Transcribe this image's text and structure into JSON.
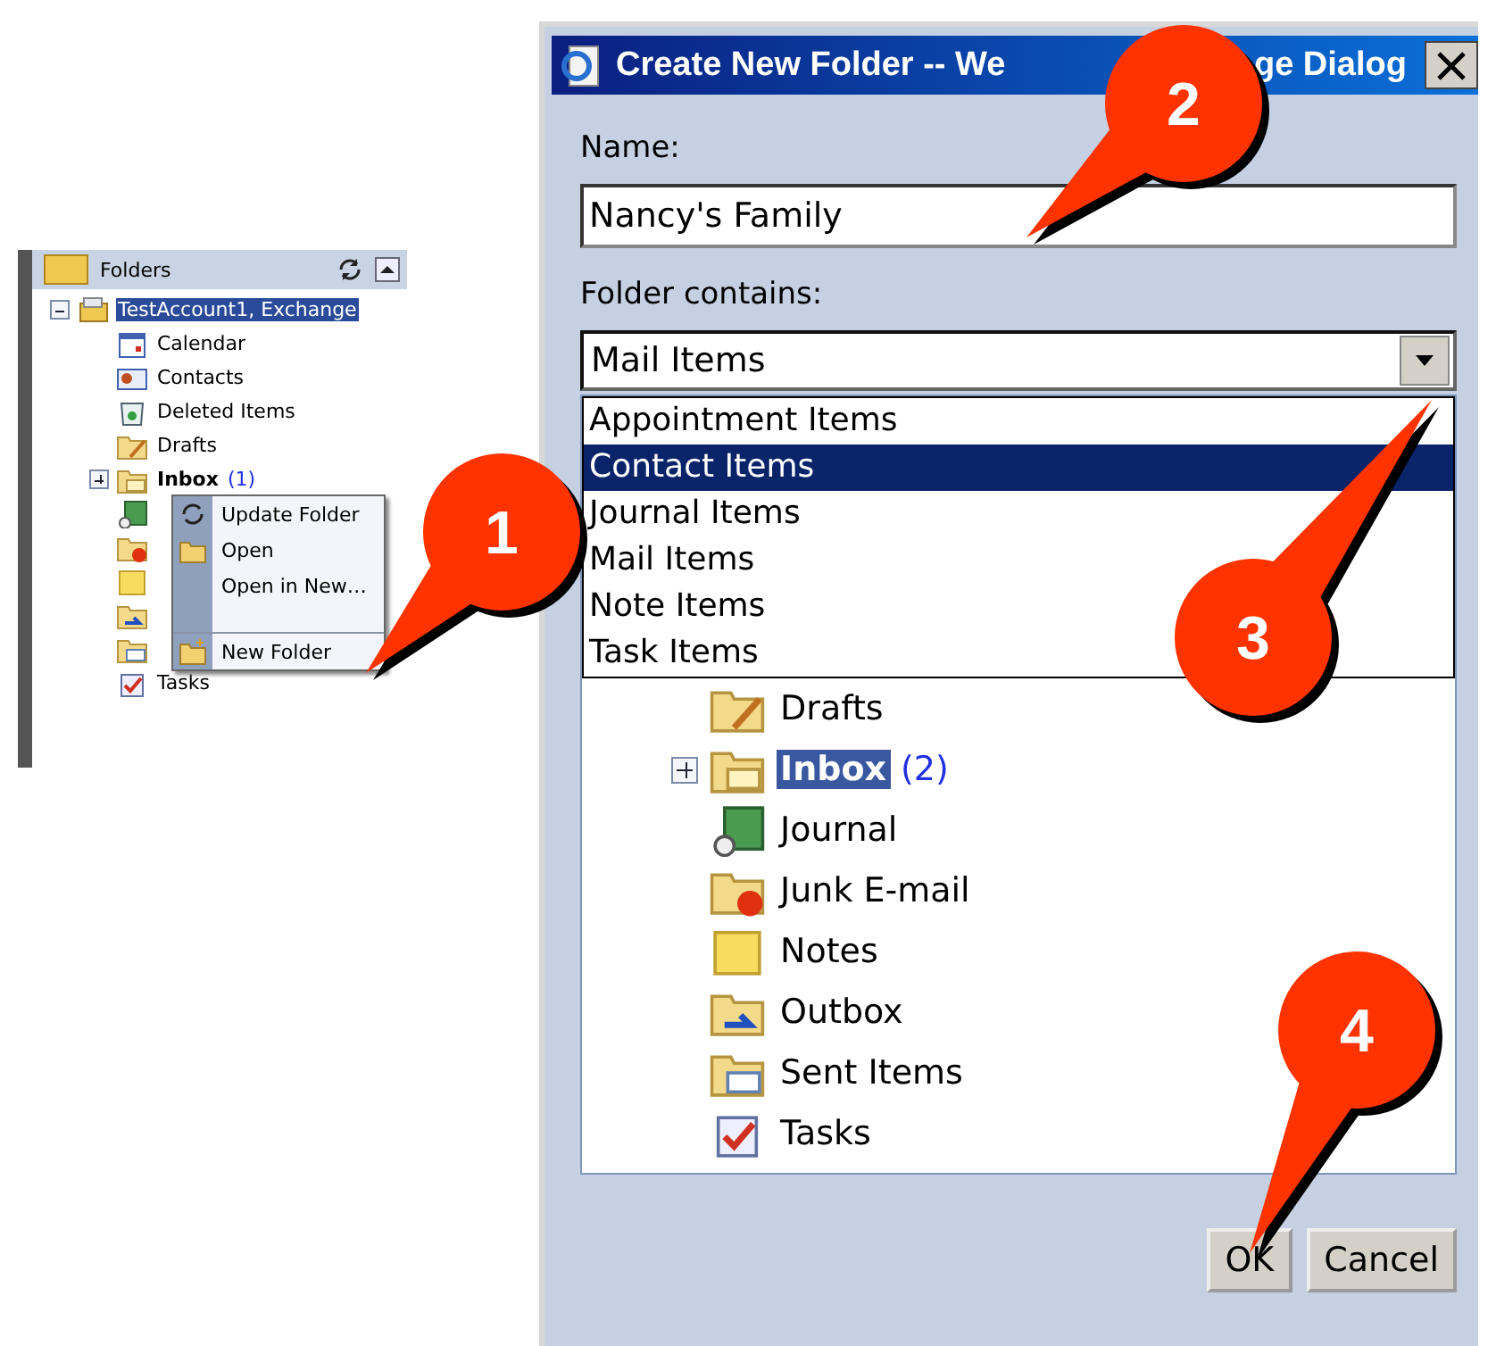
{
  "folder_pane": {
    "title": "Folders",
    "tree": [
      {
        "label": "TestAccount1, Exchange",
        "kind": "account",
        "expanded": true,
        "selected": true,
        "children": [
          {
            "label": "Calendar",
            "kind": "calendar",
            "bold": false
          },
          {
            "label": "Contacts",
            "kind": "contacts",
            "bold": false
          },
          {
            "label": "Deleted Items",
            "kind": "trash",
            "bold": false
          },
          {
            "label": "Drafts",
            "kind": "drafts",
            "bold": false
          },
          {
            "label": "Inbox",
            "count": "(1)",
            "kind": "mail",
            "bold": true,
            "expanded": false
          },
          {
            "kind": "journal"
          },
          {
            "kind": "junk"
          },
          {
            "kind": "notes"
          },
          {
            "kind": "outbox"
          },
          {
            "kind": "sent"
          },
          {
            "label": "Tasks",
            "kind": "tasks",
            "bold": false
          }
        ]
      }
    ]
  },
  "context_menu": {
    "items": [
      {
        "label": "Update Folder",
        "kind": "sync",
        "separator_before": false
      },
      {
        "label": "Open",
        "kind": "open",
        "separator_before": false
      },
      {
        "label": "Open in New…",
        "kind": "plain",
        "separator_before": false
      },
      {
        "label": "New Folder",
        "kind": "newfolder",
        "separator_before": true
      }
    ]
  },
  "dialog": {
    "title_parts": [
      "Create New Folder -- We",
      "ge Dialog"
    ],
    "name_label": "Name:",
    "name_value": "Nancy's Family",
    "contains_label": "Folder contains:",
    "contains_value": "Mail Items",
    "dropdown_options": [
      {
        "label": "Appointment Items",
        "selected": false
      },
      {
        "label": "Contact Items",
        "selected": true
      },
      {
        "label": "Journal Items",
        "selected": false
      },
      {
        "label": "Mail Items",
        "selected": false
      },
      {
        "label": "Note Items",
        "selected": false
      },
      {
        "label": "Task Items",
        "selected": false
      }
    ],
    "tree": [
      {
        "label": "Drafts",
        "kind": "drafts",
        "selected": false
      },
      {
        "label": "Inbox",
        "count": "(2)",
        "kind": "mail",
        "selected": true,
        "expanded": false
      },
      {
        "label": "Journal",
        "kind": "journal",
        "selected": false
      },
      {
        "label": "Junk E-mail",
        "kind": "junk",
        "selected": false
      },
      {
        "label": "Notes",
        "kind": "notes",
        "selected": false
      },
      {
        "label": "Outbox",
        "kind": "outbox",
        "selected": false
      },
      {
        "label": "Sent Items",
        "kind": "sent",
        "selected": false
      },
      {
        "label": "Tasks",
        "kind": "tasks",
        "selected": false
      }
    ],
    "buttons": [
      "OK",
      "Cancel"
    ]
  },
  "callouts": [
    {
      "number": "1"
    },
    {
      "number": "2"
    },
    {
      "number": "3"
    },
    {
      "number": "4"
    }
  ]
}
